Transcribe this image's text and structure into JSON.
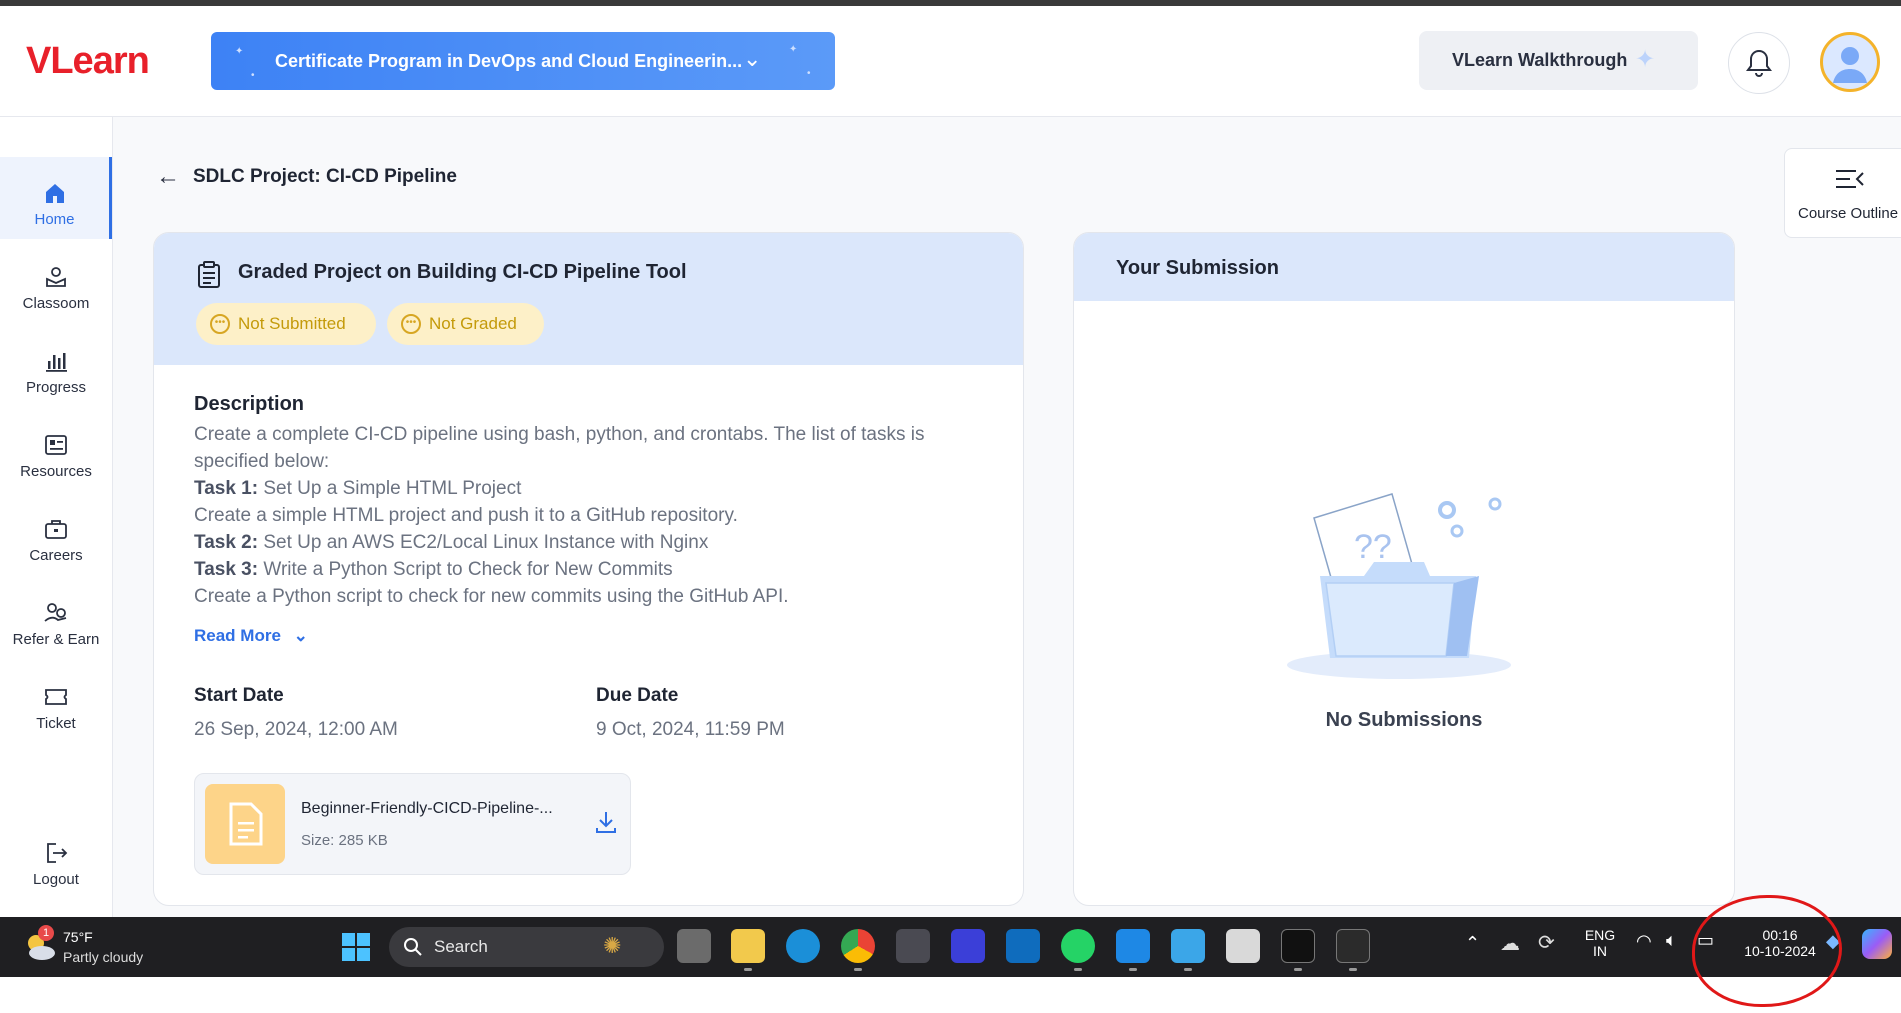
{
  "header": {
    "logo": "VLearn",
    "course_select": "Certificate Program in DevOps and Cloud Engineerin...",
    "walkthrough": "VLearn Walkthrough"
  },
  "sidebar": {
    "items": [
      {
        "label": "Home",
        "icon": "home-icon",
        "active": true
      },
      {
        "label": "Classoom",
        "icon": "classroom-icon"
      },
      {
        "label": "Progress",
        "icon": "bar-chart-icon"
      },
      {
        "label": "Resources",
        "icon": "resources-icon"
      },
      {
        "label": "Careers",
        "icon": "briefcase-icon"
      },
      {
        "label": "Refer & Earn",
        "icon": "refer-icon"
      },
      {
        "label": "Ticket",
        "icon": "ticket-icon"
      }
    ],
    "logout": "Logout"
  },
  "page": {
    "title": "SDLC Project: CI-CD Pipeline",
    "course_outline": "Course Outline"
  },
  "project": {
    "title": "Graded Project on Building CI-CD Pipeline Tool",
    "badges": [
      "Not Submitted",
      "Not Graded"
    ],
    "description_heading": "Description",
    "description_intro": "Create a complete CI-CD pipeline using bash, python, and crontabs. The list of tasks is specified below:",
    "task1_label": "Task 1:",
    "task1_text": " Set Up a Simple HTML Project",
    "task1_detail": "Create a simple HTML project and push it to a GitHub repository.",
    "task2_label": "Task 2:",
    "task2_text": " Set Up an AWS EC2/Local Linux Instance with Nginx",
    "task3_label": "Task 3:",
    "task3_text": " Write a Python Script to Check for New Commits",
    "task3_detail": " Create a Python script to check for new commits using the GitHub API.",
    "read_more": "Read More",
    "start_label": "Start Date",
    "start_value": "26 Sep, 2024, 12:00 AM",
    "due_label": "Due Date",
    "due_value": "9 Oct, 2024, 11:59 PM",
    "file_name": "Beginner-Friendly-CICD-Pipeline-...",
    "file_size": "Size: 285 KB"
  },
  "submission": {
    "title": "Your Submission",
    "empty": "No Submissions"
  },
  "taskbar": {
    "weather_temp": "75°F",
    "weather_desc": "Partly cloudy",
    "weather_badge": "1",
    "search": "Search",
    "lang_1": "ENG",
    "lang_2": "IN",
    "time": "00:16",
    "date": "10-10-2024"
  },
  "colors": {
    "accent": "#2f6fe4",
    "brand_red": "#e8202a",
    "header_blue": "#dbe7fb",
    "badge_bg": "#fdf0c8",
    "badge_text": "#c49a0a"
  }
}
